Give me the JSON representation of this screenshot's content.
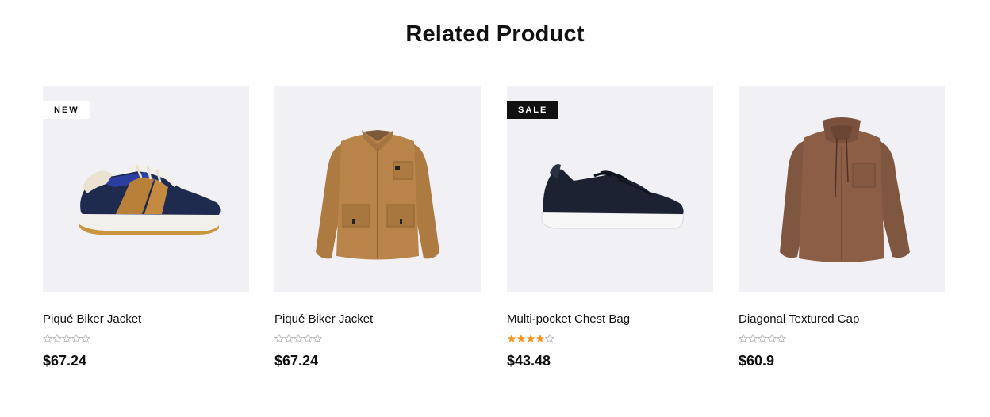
{
  "section": {
    "title": "Related Product"
  },
  "colors": {
    "accent_star": "#f7941d",
    "empty_star": "#b5b5b5",
    "thumb_bg": "#f0f0f5"
  },
  "products": [
    {
      "name": "Piqué Biker Jacket",
      "price": "$67.24",
      "rating": 0,
      "badge": "NEW",
      "image": "sneaker-blue-brown"
    },
    {
      "name": "Piqué Biker Jacket",
      "price": "$67.24",
      "rating": 0,
      "badge": "",
      "image": "jacket-tan"
    },
    {
      "name": "Multi-pocket Chest Bag",
      "price": "$43.48",
      "rating": 4,
      "badge": "SALE",
      "image": "sneaker-navy"
    },
    {
      "name": "Diagonal Textured Cap",
      "price": "$60.9",
      "rating": 0,
      "badge": "",
      "image": "hooded-shirt-brown"
    }
  ]
}
